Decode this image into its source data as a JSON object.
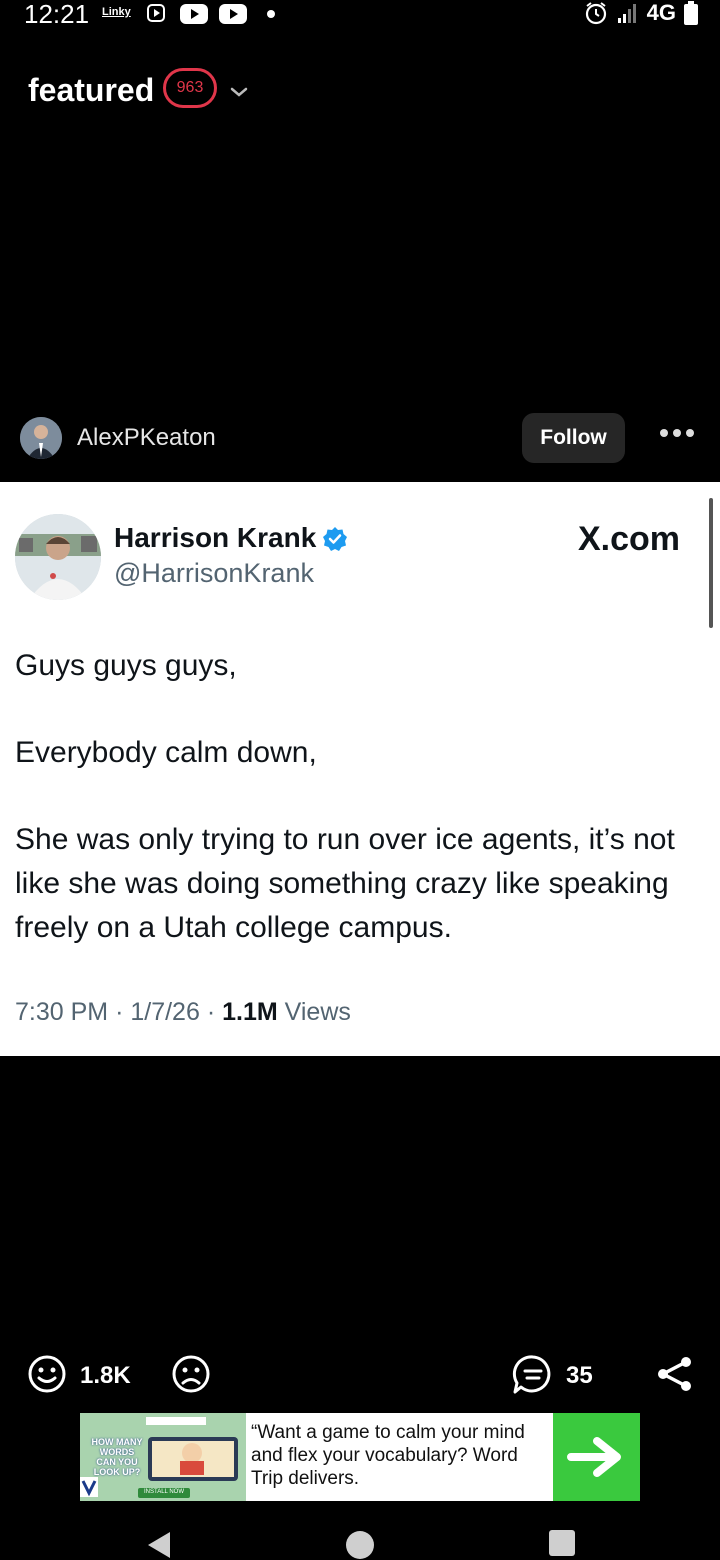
{
  "status_bar": {
    "time": "12:21",
    "app_label": "Linky",
    "network": "4G",
    "icons": [
      "play-box-icon",
      "youtube-icon",
      "youtube-icon",
      "dot-icon",
      "alarm-icon",
      "signal-icon",
      "battery-icon"
    ]
  },
  "header": {
    "title": "featured",
    "badge_count": "963"
  },
  "author": {
    "username": "AlexPKeaton",
    "follow_label": "Follow"
  },
  "tweet": {
    "name": "Harrison Krank",
    "handle": "@HarrisonKrank",
    "source": "X.com",
    "paragraphs": [
      "Guys guys guys,",
      "Everybody calm down,",
      "She was only trying to run over ice agents, it’s not like she was doing something crazy like speaking freely on a Utah college campus."
    ],
    "time": "7:30 PM",
    "date": "1/7/26",
    "views_count": "1.1M",
    "views_label": "Views"
  },
  "actions": {
    "upvotes": "1.8K",
    "comments": "35"
  },
  "ad": {
    "image_lines": [
      "HOW MANY",
      "WORDS",
      "CAN YOU",
      "LOOK UP?"
    ],
    "install_label": "INSTALL NOW",
    "text": "“Want a game to calm your mind and flex your vocabulary? Word Trip delivers."
  },
  "colors": {
    "badge": "#e0364a",
    "verified": "#1d9bf0",
    "ad_cta": "#3ac93e",
    "follow_bg": "#262626"
  }
}
